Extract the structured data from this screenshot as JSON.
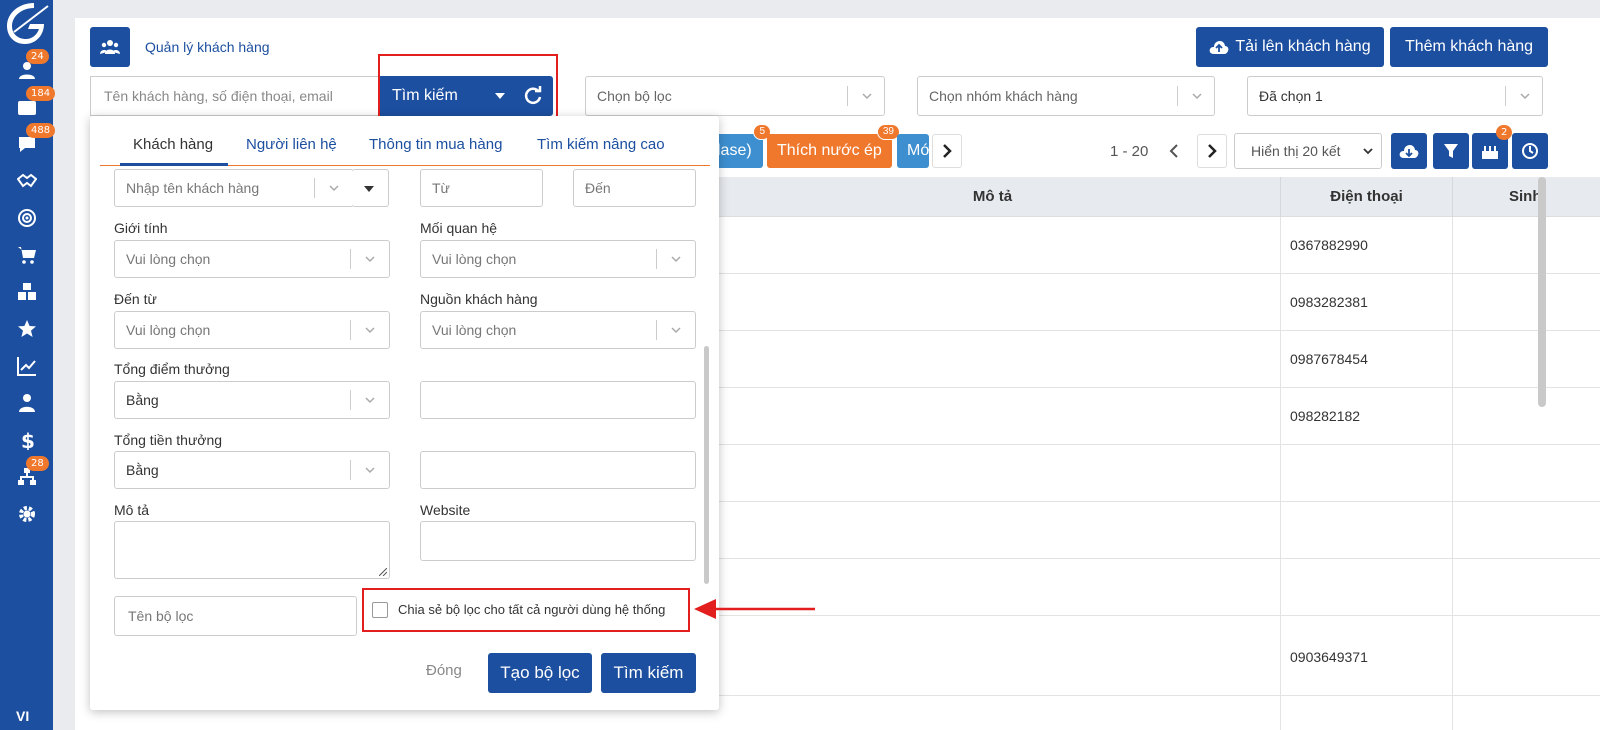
{
  "sidebar": {
    "items": [
      {
        "icon": "contacts-icon",
        "badge": "24"
      },
      {
        "icon": "inbox-icon",
        "badge": "184"
      },
      {
        "icon": "messages-icon",
        "badge": "488"
      },
      {
        "icon": "handshake-icon",
        "badge": ""
      },
      {
        "icon": "target-icon",
        "badge": ""
      },
      {
        "icon": "cart-icon",
        "badge": ""
      },
      {
        "icon": "boxes-icon",
        "badge": ""
      },
      {
        "icon": "star-icon",
        "badge": ""
      },
      {
        "icon": "chart-line-icon",
        "badge": ""
      },
      {
        "icon": "user-tie-icon",
        "badge": ""
      },
      {
        "icon": "dollar-icon",
        "badge": ""
      },
      {
        "icon": "sitemap-icon",
        "badge": "28"
      },
      {
        "icon": "gear-icon",
        "badge": ""
      }
    ],
    "language": "VI"
  },
  "header": {
    "title": "Quản lý khách hàng",
    "upload_label": "Tải lên khách hàng",
    "add_label": "Thêm khách hàng"
  },
  "search": {
    "placeholder": "Tên khách hàng, số điện thoại, email",
    "button_label": "Tìm kiếm"
  },
  "filters": {
    "filter_placeholder": "Chọn bộ lọc",
    "group_placeholder": "Chọn nhóm khách hàng",
    "selected_text": "Đã chọn 1"
  },
  "chips": [
    {
      "label": "lase)",
      "badge": "5",
      "color": "#3d8fd0"
    },
    {
      "label": "Thích nước ép",
      "badge": "39",
      "color": "#f0782d"
    },
    {
      "label": "Mớ",
      "badge": "",
      "color": "#3d8fd0"
    }
  ],
  "pager": {
    "range": "1 - 20",
    "page_size": "Hiển thị 20 kết",
    "filter_badge": "2"
  },
  "table": {
    "headers": [
      "Mô tả",
      "Điện thoại",
      "Sinh"
    ],
    "phones": [
      "0367882990",
      "0983282381",
      "0987678454",
      "098282182",
      "",
      "",
      "",
      "0903649371"
    ]
  },
  "panel": {
    "tabs": [
      "Khách hàng",
      "Người liên hệ",
      "Thông tin mua hàng",
      "Tìm kiếm nâng cao"
    ],
    "name_placeholder": "Nhập tên khách hàng",
    "from_placeholder": "Từ",
    "to_placeholder": "Đến",
    "gender_label": "Giới tính",
    "relation_label": "Mối quan hệ",
    "source_from_label": "Đến từ",
    "customer_source_label": "Nguồn khách hàng",
    "choose_placeholder": "Vui lòng chọn",
    "points_label": "Tổng điểm thưởng",
    "reward_label": "Tổng tiền thưởng",
    "equals_value": "Bằng",
    "desc_label": "Mô tả",
    "website_label": "Website",
    "filter_name_placeholder": "Tên bộ lọc",
    "share_label": "Chia sẻ bộ lọc cho tất cả người dùng hệ thống",
    "close_label": "Đóng",
    "create_label": "Tạo bộ lọc",
    "search_label": "Tìm kiếm"
  },
  "colors": {
    "primary": "#1c4fa0",
    "accent": "#f0782d",
    "highlight": "#e21e1e"
  }
}
